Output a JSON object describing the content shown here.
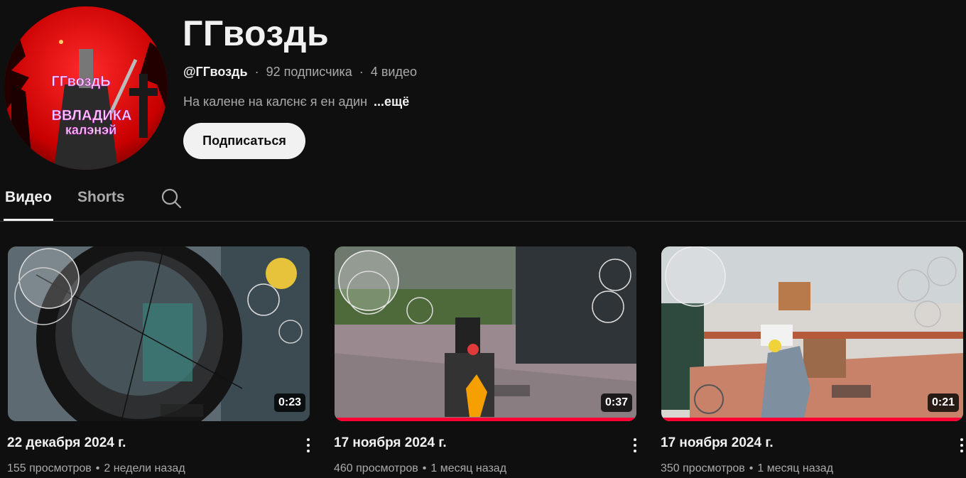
{
  "channel": {
    "name": "ГГвоздь",
    "handle": "@ГГвоздь",
    "subscribers": "92 подписчика",
    "video_count": "4 видео",
    "description": "На калене на калєнє я ен адин",
    "more_label": "...ещё",
    "subscribe_label": "Подписаться",
    "avatar_text": [
      "ГГвоздЬ",
      "ВВЛАДИКА",
      "калэнэй"
    ]
  },
  "tabs": [
    {
      "label": "Видео",
      "active": true
    },
    {
      "label": "Shorts",
      "active": false
    }
  ],
  "videos": [
    {
      "title": "22 декабря 2024 г.",
      "views": "155 просмотров",
      "age": "2 недели назад",
      "duration": "0:23",
      "watched_fraction": 0
    },
    {
      "title": "17 ноября 2024 г.",
      "views": "460 просмотров",
      "age": "1 месяц назад",
      "duration": "0:37",
      "watched_fraction": 1
    },
    {
      "title": "17 ноября 2024 г.",
      "views": "350 просмотров",
      "age": "1 месяц назад",
      "duration": "0:21",
      "watched_fraction": 1
    }
  ],
  "icons": [
    "search-icon",
    "more-vert-icon"
  ],
  "colors": {
    "background": "#0f0f0f",
    "accent": "#ff0033",
    "text": "#f1f1f1",
    "muted": "#aaaaaa"
  }
}
